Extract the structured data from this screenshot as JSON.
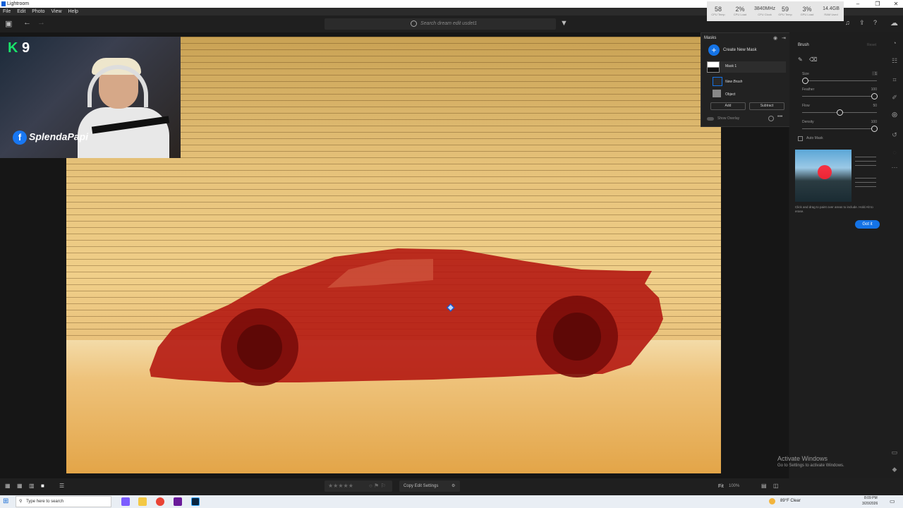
{
  "window": {
    "title": "Lightroom"
  },
  "menu": [
    "File",
    "Edit",
    "Photo",
    "View",
    "Help"
  ],
  "window_controls": {
    "minimize": "–",
    "maximize": "❐",
    "close": "✕"
  },
  "search": {
    "placeholder": "Search dream edit usdet1"
  },
  "stats": [
    {
      "value": "58",
      "label": "CPU Temp"
    },
    {
      "value": "2%",
      "label": "CPU Load"
    },
    {
      "value": "3840MHz",
      "label": "CPU Clock"
    },
    {
      "value": "59",
      "label": "GPU Temp"
    },
    {
      "value": "3%",
      "label": "GPU Load"
    },
    {
      "value": "14.4GB",
      "label": "RAM Used"
    }
  ],
  "webcam": {
    "badge_letter": "K",
    "badge_number": "9",
    "handle": "SplendaPapi"
  },
  "masks": {
    "header": "Masks",
    "create_label": "Create New Mask",
    "items": [
      {
        "label": "Mask 1"
      },
      {
        "label": "New Brush"
      },
      {
        "label": "Object"
      }
    ],
    "add_label": "Add",
    "subtract_label": "Subtract",
    "overlay_label": "Show Overlay"
  },
  "brush": {
    "title": "Brush",
    "reset_label": "Reset",
    "sliders": [
      {
        "label": "Size",
        "value": "1",
        "level": 0.0
      },
      {
        "label": "Feather",
        "value": "100",
        "level": 1.0
      },
      {
        "label": "Flow",
        "value": "50",
        "level": 0.5
      },
      {
        "label": "Density",
        "value": "100",
        "level": 1.0
      }
    ],
    "auto_mask_label": "Auto Mask",
    "tip_text": "Click and drag to paint over areas to include. Hold Alt to erase.",
    "got_it_label": "Got it"
  },
  "activate_windows": {
    "line1": "Activate Windows",
    "line2": "Go to Settings to activate Windows."
  },
  "bottom": {
    "copy_edit": "Copy Edit Settings",
    "fit": "Fit",
    "zoom": "100%"
  },
  "taskbar": {
    "search_placeholder": "Type here to search",
    "weather": "89°F  Clear",
    "time": "8:09 PM",
    "date": "3/20/2026"
  }
}
